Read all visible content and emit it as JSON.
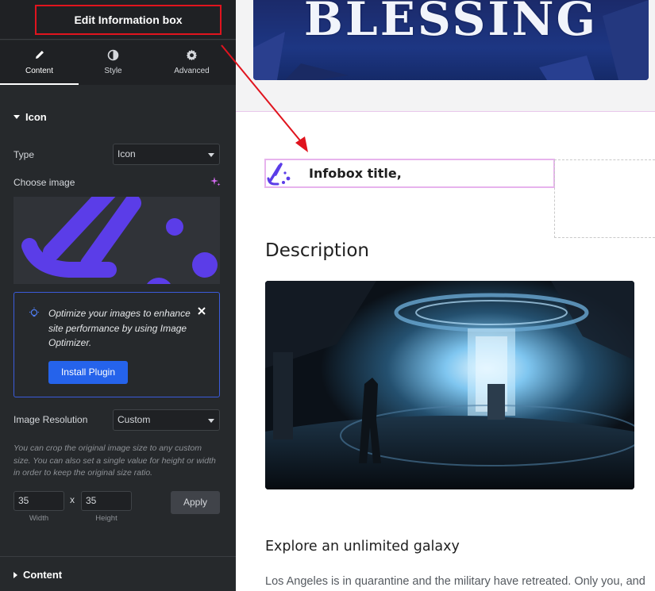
{
  "panel": {
    "title": "Edit Information box",
    "tabs": [
      {
        "label": "Content",
        "icon": "pencil-icon",
        "active": true
      },
      {
        "label": "Style",
        "icon": "half-circle-icon",
        "active": false
      },
      {
        "label": "Advanced",
        "icon": "gear-icon",
        "active": false
      }
    ],
    "sections": {
      "icon": {
        "heading": "Icon",
        "type_label": "Type",
        "type_value": "Icon",
        "choose_image_label": "Choose image",
        "notice": {
          "text": "Optimize your images to enhance site performance by using Image Optimizer.",
          "button": "Install Plugin"
        },
        "resolution_label": "Image Resolution",
        "resolution_value": "Custom",
        "help_text": "You can crop the original image size to any custom size. You can also set a single value for height or width in order to keep the original size ratio.",
        "width_value": "35",
        "height_value": "35",
        "separator": "x",
        "width_label": "Width",
        "height_label": "Height",
        "apply_button": "Apply"
      },
      "content": {
        "heading": "Content"
      }
    },
    "collapse_glyph": "‹"
  },
  "preview": {
    "hero_text": "BLESSING",
    "infobox_title": "Infobox title,",
    "description_heading": "Description",
    "explore_heading": "Explore an unlimited galaxy",
    "paragraph": "Los Angeles is in quarantine and the military have retreated. Only you, and"
  },
  "colors": {
    "panel_bg": "#26292c",
    "accent_blue": "#2563eb",
    "icon_purple": "#5b3de8",
    "annotation_red": "#e0141e",
    "infobox_border": "#e7b3ed"
  }
}
